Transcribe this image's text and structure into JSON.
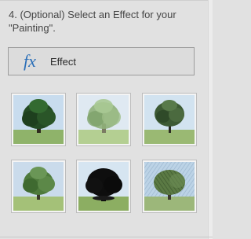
{
  "step": {
    "title": "4. (Optional) Select an Effect for your \"Painting\"."
  },
  "effect_button": {
    "icon": "fx-icon",
    "label": "Effect"
  },
  "effect_thumbnails": [
    {
      "style": "dark-oil"
    },
    {
      "style": "soft-wash"
    },
    {
      "style": "detailed-sketch"
    },
    {
      "style": "fresco"
    },
    {
      "style": "silhouette"
    },
    {
      "style": "crosshatch"
    }
  ],
  "colors": {
    "panel_bg": "#e1e1e1",
    "text": "#454545",
    "fx_icon": "#2b6fb8"
  }
}
